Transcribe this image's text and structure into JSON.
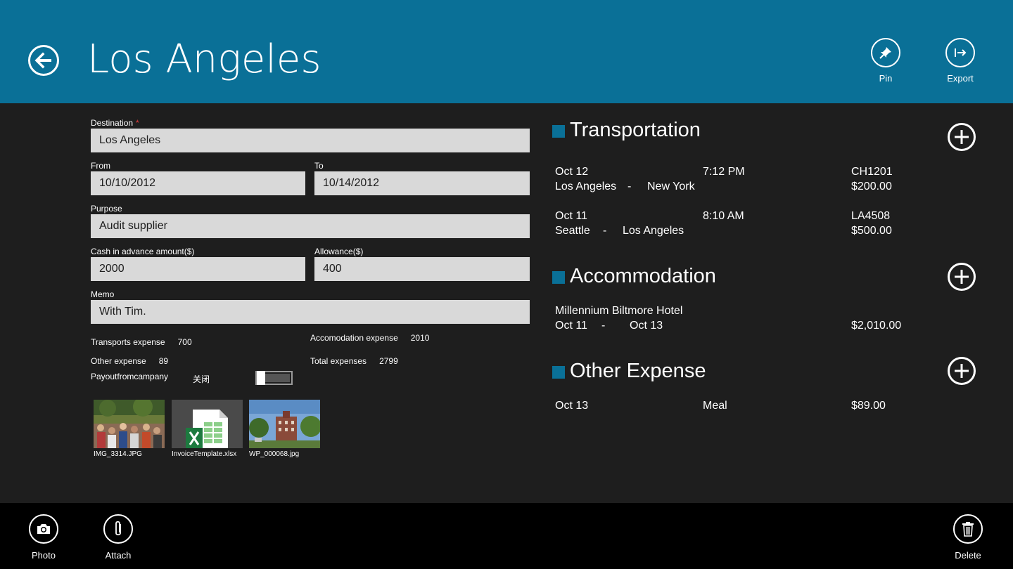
{
  "header": {
    "title": "Los Angeles",
    "pin_label": "Pin",
    "export_label": "Export"
  },
  "form": {
    "destination_label": "Destination",
    "required_mark": "*",
    "destination_value": "Los Angeles",
    "from_label": "From",
    "from_value": "10/10/2012",
    "to_label": "To",
    "to_value": "10/14/2012",
    "purpose_label": "Purpose",
    "purpose_value": "Audit supplier",
    "cash_label": "Cash in advance amount($)",
    "cash_value": "2000",
    "allowance_label": "Allowance($)",
    "allowance_value": "400",
    "memo_label": "Memo",
    "memo_value": "With Tim."
  },
  "summary": {
    "transports_label": "Transports expense",
    "transports_value": "700",
    "accommodation_label": "Accomodation expense",
    "accommodation_value": "2010",
    "other_label": "Other expense",
    "other_value": "89",
    "total_label": "Total expenses",
    "total_value": "2799",
    "payout_label": "Payoutfromcampany",
    "payout_state": "关闭"
  },
  "attachments": [
    {
      "name": "IMG_3314.JPG"
    },
    {
      "name": "InvoiceTemplate.xlsx"
    },
    {
      "name": "WP_000068.jpg"
    }
  ],
  "sections": {
    "transportation": {
      "title": "Transportation",
      "items": [
        {
          "date": "Oct 12",
          "time": "7:12 PM",
          "code": "CH1201",
          "from": "Los Angeles",
          "sep": "-",
          "to": "New York",
          "amount": "$200.00"
        },
        {
          "date": "Oct 11",
          "time": "8:10 AM",
          "code": "LA4508",
          "from": "Seattle",
          "sep": "-",
          "to": "Los Angeles",
          "amount": "$500.00"
        }
      ]
    },
    "accommodation": {
      "title": "Accommodation",
      "items": [
        {
          "hotel": "Millennium Biltmore Hotel",
          "from": "Oct 11",
          "sep": "-",
          "to": "Oct 13",
          "amount": "$2,010.00"
        }
      ]
    },
    "other": {
      "title": "Other Expense",
      "items": [
        {
          "date": "Oct 13",
          "type": "Meal",
          "amount": "$89.00"
        }
      ]
    }
  },
  "appbar": {
    "photo_label": "Photo",
    "attach_label": "Attach",
    "delete_label": "Delete"
  },
  "colors": {
    "accent": "#0a7097",
    "background": "#1e1e1e",
    "appbar": "#000000",
    "input": "#d9d9d9"
  }
}
